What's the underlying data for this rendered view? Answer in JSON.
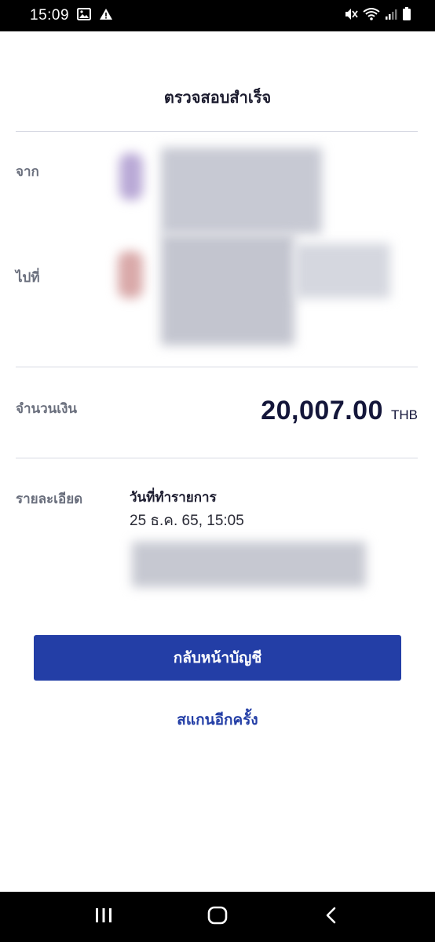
{
  "status_bar": {
    "time": "15:09",
    "left_icons": [
      "image-icon",
      "warning-icon"
    ],
    "right_icons": [
      "mute-vibrate-icon",
      "wifi-icon",
      "signal-icon",
      "battery-icon"
    ]
  },
  "header": {
    "title": "ตรวจสอบสำเร็จ"
  },
  "transfer": {
    "from_label": "จาก",
    "to_label": "ไปที่"
  },
  "amount": {
    "label": "จำนวนเงิน",
    "value": "20,007.00",
    "currency": "THB"
  },
  "details": {
    "label": "รายละเอียด",
    "date_heading": "วันที่ทำรายการ",
    "date_value": "25 ธ.ค. 65, 15:05"
  },
  "actions": {
    "primary_label": "กลับหน้าบัญชี",
    "secondary_label": "สแกนอีกครั้ง"
  },
  "nav_bar": {
    "items": [
      "recent-apps-icon",
      "home-icon",
      "back-icon"
    ]
  },
  "colors": {
    "primary": "#233ea6",
    "amount_text": "#14163a",
    "label_text": "#6a6f7d",
    "divider": "#d7d9e3"
  }
}
